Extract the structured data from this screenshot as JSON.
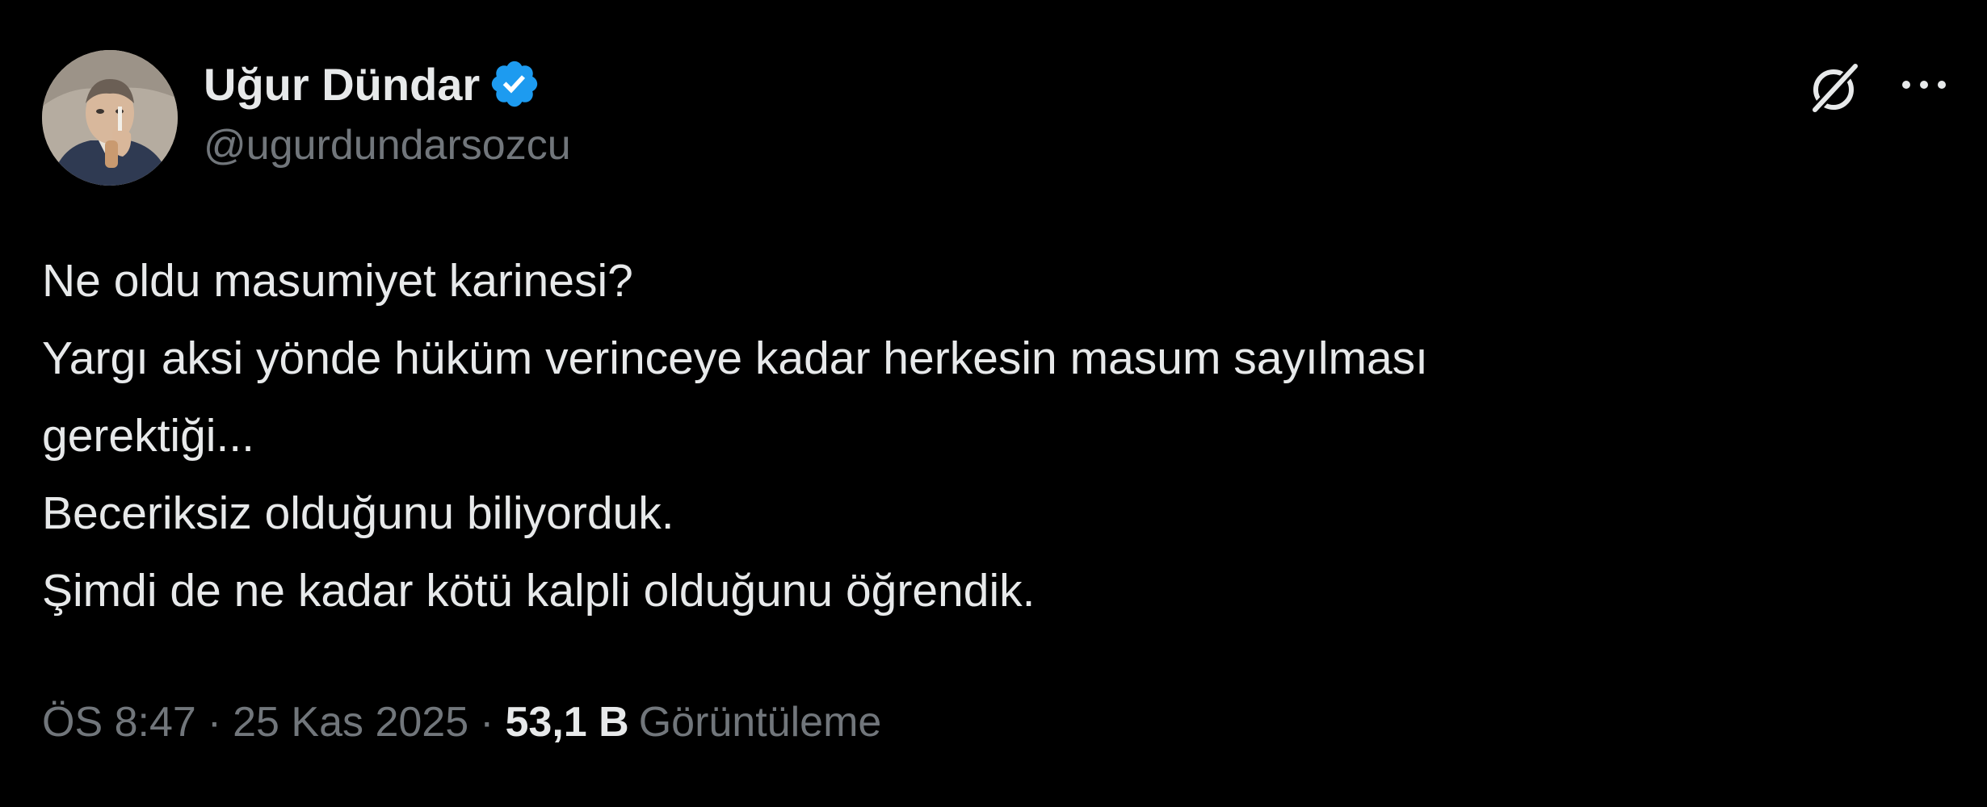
{
  "author": {
    "display_name": "Uğur Dündar",
    "handle": "@ugurdundarsozcu",
    "verified": true,
    "avatar_icon": "portrait-avatar"
  },
  "header_actions": {
    "grok_icon": "grok-icon",
    "more_icon": "more-dots-icon"
  },
  "tweet": {
    "lines": [
      "Ne oldu masumiyet karinesi?",
      "Yargı aksi yönde hüküm verinceye kadar herkesin masum sayılması",
      "gerektiği...",
      "Beceriksiz olduğunu biliyorduk.",
      "Şimdi de ne kadar kötü kalpli olduğunu öğrendik."
    ]
  },
  "meta": {
    "time": "ÖS 8:47",
    "separator": "·",
    "date": "25 Kas 2025",
    "views_count": "53,1 B",
    "views_label": "Görüntüleme"
  },
  "colors": {
    "background": "#000000",
    "primary_text": "#e7e9ea",
    "secondary_text": "#71767b",
    "verified_badge": "#1d9bf0"
  }
}
